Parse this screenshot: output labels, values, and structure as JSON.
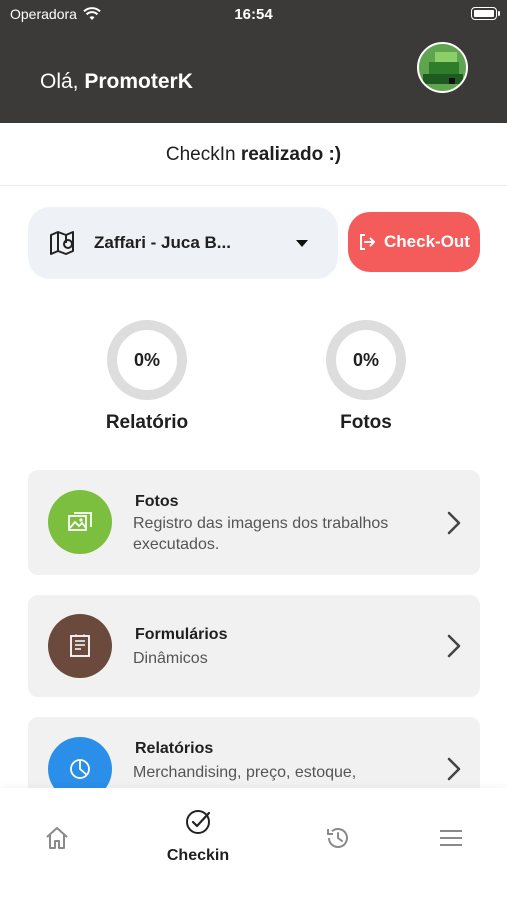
{
  "status_bar": {
    "carrier": "Operadora",
    "time": "16:54"
  },
  "header": {
    "greeting_prefix": "Olá, ",
    "user_name": "PromoterK"
  },
  "checkin_banner": {
    "prefix": "CheckIn ",
    "status": "realizado :)"
  },
  "store_selector": {
    "selected": "Zaffari - Juca B..."
  },
  "checkout_button": {
    "label": "Check-Out",
    "color": "#f45b5b"
  },
  "progress": [
    {
      "label": "Relatório",
      "value": "0%"
    },
    {
      "label": "Fotos",
      "value": "0%"
    }
  ],
  "cards": [
    {
      "title": "Fotos",
      "description": "Registro das imagens dos trabalhos executados.",
      "icon": "image-icon",
      "color": "#7cbf3f"
    },
    {
      "title": "Formulários",
      "description": "Dinâmicos",
      "icon": "form-icon",
      "color": "#6b4a3d"
    },
    {
      "title": "Relatórios",
      "description": "Merchandising, preço, estoque,",
      "icon": "pie-chart-icon",
      "color": "#2b8ee8"
    }
  ],
  "bottom_nav": [
    {
      "icon": "home-icon",
      "label": ""
    },
    {
      "icon": "check-circle-icon",
      "label": "Checkin"
    },
    {
      "icon": "history-icon",
      "label": ""
    },
    {
      "icon": "menu-icon",
      "label": ""
    }
  ]
}
